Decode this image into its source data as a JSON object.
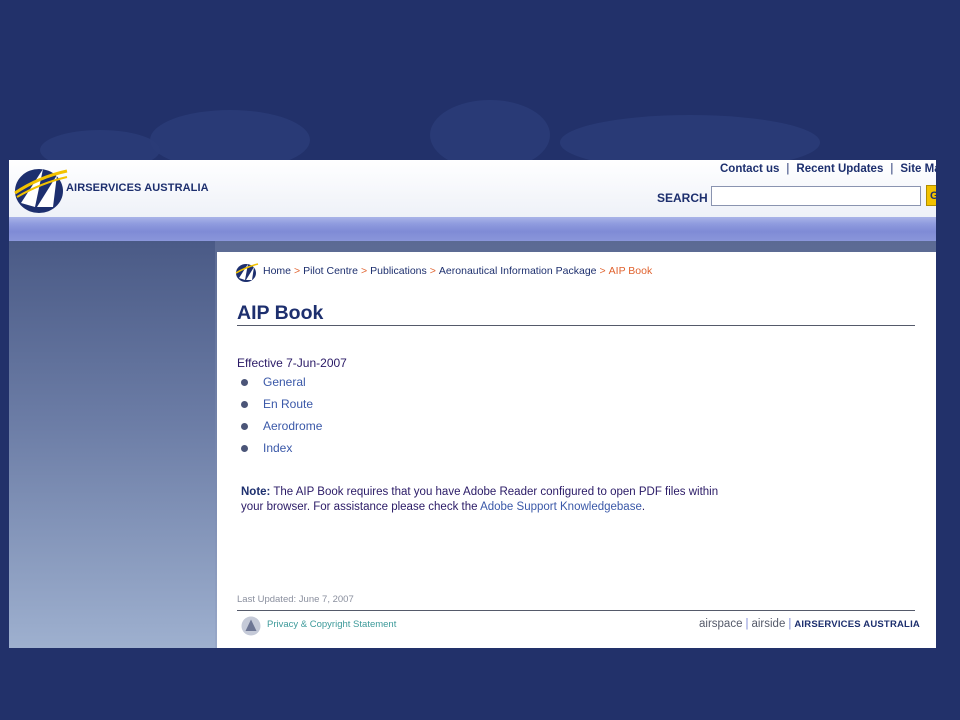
{
  "brand": {
    "name": "AIRSERVICES AUSTRALIA"
  },
  "toplinks": {
    "contact": "Contact us",
    "updates": "Recent Updates",
    "sitemap": "Site Map"
  },
  "search": {
    "label": "SEARCH",
    "placeholder": "",
    "button": "Go"
  },
  "breadcrumb": [
    "Home",
    "Pilot Centre",
    "Publications",
    "Aeronautical Information Package",
    "AIP Book"
  ],
  "page": {
    "title": "AIP Book",
    "effective": "Effective 7-Jun-2007",
    "links": [
      "General",
      "En Route",
      "Aerodrome",
      "Index"
    ],
    "note": {
      "label": "Note:",
      "text": " The AIP Book requires that you have Adobe Reader configured to open PDF files within your browser. For assistance please check the ",
      "link": "Adobe Support Knowledgebase",
      "end": "."
    },
    "last_updated": "Last Updated: June 7, 2007"
  },
  "footer": {
    "privacy": "Privacy & Copyright Statement",
    "tagline_airspace": "airspace",
    "tagline_airside": "airside",
    "tagline_brand": "AIRSERVICES AUSTRALIA"
  },
  "colors": {
    "navy": "#1d2f6e",
    "accent": "#e0622e",
    "link": "#3a58a8",
    "nav": "#7f8bd6",
    "background": "#22316a"
  }
}
